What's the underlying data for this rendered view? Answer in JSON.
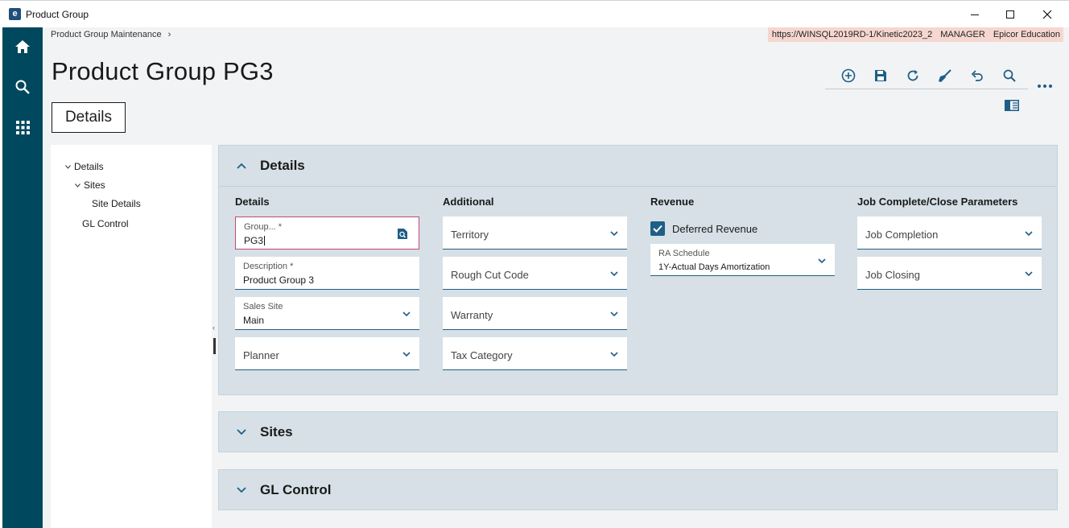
{
  "window": {
    "app_icon_letter": "e",
    "title": "Product Group"
  },
  "breadcrumb": {
    "item": "Product Group Maintenance",
    "separator": "›"
  },
  "environment": {
    "url": "https://WINSQL2019RD-1/Kinetic2023_2",
    "user": "MANAGER",
    "company": "Epicor Education"
  },
  "page": {
    "title": "Product Group PG3",
    "active_tab": "Details"
  },
  "toolbar": {
    "icons": [
      "add-new-icon",
      "save-icon",
      "refresh-icon",
      "clear-icon",
      "undo-icon",
      "search-icon"
    ]
  },
  "tree": {
    "items": [
      {
        "label": "Details"
      },
      {
        "label": "Sites"
      },
      {
        "label": "Site Details"
      },
      {
        "label": "GL Control"
      }
    ]
  },
  "details_card": {
    "title": "Details",
    "columns": {
      "details": "Details",
      "additional": "Additional",
      "revenue": "Revenue",
      "job": "Job Complete/Close Parameters"
    },
    "group": {
      "label": "Group... *",
      "value": "PG3"
    },
    "description": {
      "label": "Description *",
      "value": "Product Group 3"
    },
    "sales_site": {
      "label": "Sales Site",
      "value": "Main"
    },
    "planner": {
      "placeholder": "Planner"
    },
    "territory": {
      "placeholder": "Territory"
    },
    "rough_cut_code": {
      "placeholder": "Rough Cut Code"
    },
    "warranty": {
      "placeholder": "Warranty"
    },
    "tax_category": {
      "placeholder": "Tax Category"
    },
    "deferred_revenue": {
      "label": "Deferred Revenue",
      "checked": true
    },
    "ra_schedule": {
      "label": "RA Schedule",
      "value": "1Y-Actual Days Amortization"
    },
    "job_completion": {
      "placeholder": "Job Completion"
    },
    "job_closing": {
      "placeholder": "Job Closing"
    }
  },
  "sites_card": {
    "title": "Sites"
  },
  "gl_card": {
    "title": "GL Control"
  },
  "colors": {
    "nav_rail": "#00485e",
    "accent": "#1f5e86",
    "card_bg": "#d6e0e6",
    "env_bar": "#f6d7d0",
    "focus_border": "#c0497a"
  }
}
